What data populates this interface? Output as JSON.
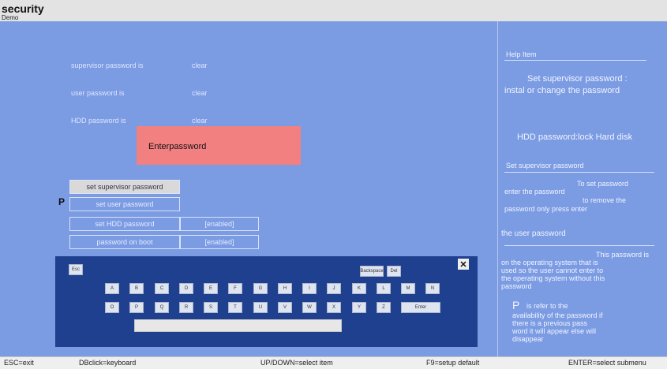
{
  "app": {
    "title": "security",
    "subtitle": "Demo"
  },
  "fields": [
    {
      "label": "supervisor password is",
      "value": "clear"
    },
    {
      "label": "user password is",
      "value": "clear"
    },
    {
      "label": "HDD password is",
      "value": "clear"
    }
  ],
  "enter_prompt": "Enterpassword",
  "menu": {
    "set_supervisor": "set supervisor password",
    "set_user": "set user password",
    "set_hdd": "set HDD password",
    "set_hdd_status": "[enabled]",
    "password_on_boot": "password on boot",
    "password_on_boot_status": "[enabled]",
    "p_marker": "P"
  },
  "keyboard": {
    "esc": "Esc",
    "backspace": "Backspace",
    "del": "Del",
    "close": "✕",
    "row1": [
      "A",
      "B",
      "C",
      "D",
      "E",
      "F",
      "G",
      "H",
      "I",
      "J",
      "K",
      "L",
      "M",
      "N"
    ],
    "row2": [
      "O",
      "P",
      "Q",
      "R",
      "S",
      "T",
      "U",
      "V",
      "W",
      "X",
      "Y",
      "Z"
    ],
    "enter": "Enter"
  },
  "help": {
    "heading": "Help Item",
    "summary1": "Set supervisor password :",
    "summary2": "instal or change the password",
    "hdd_text": "HDD password:lock Hard disk",
    "section1_title": "Set supervisor password",
    "section1_line1": "To set password",
    "section1_line2": "enter the password",
    "section1_line3": "to remove the",
    "section1_line4": "password only press enter",
    "section2_title": "the user password",
    "section2_line1": "This password is",
    "section2_line2": "on the operating system that is",
    "section2_line3": "used so the user cannot enter to",
    "section2_line4": "the operating system without this",
    "section2_line5": "password",
    "p_letter": "P",
    "p_line1": "is refer to the",
    "p_line2": "availability of the password if",
    "p_line3": "there is a previous pass",
    "p_line4": "word it will appear else will",
    "p_line5": "disappear"
  },
  "footer": {
    "esc": "ESC=exit",
    "dbclick": "DBclick=keyboard",
    "updown": "UP/DOWN=select item",
    "f9": "F9=setup default",
    "enter": "ENTER=select submenu"
  }
}
